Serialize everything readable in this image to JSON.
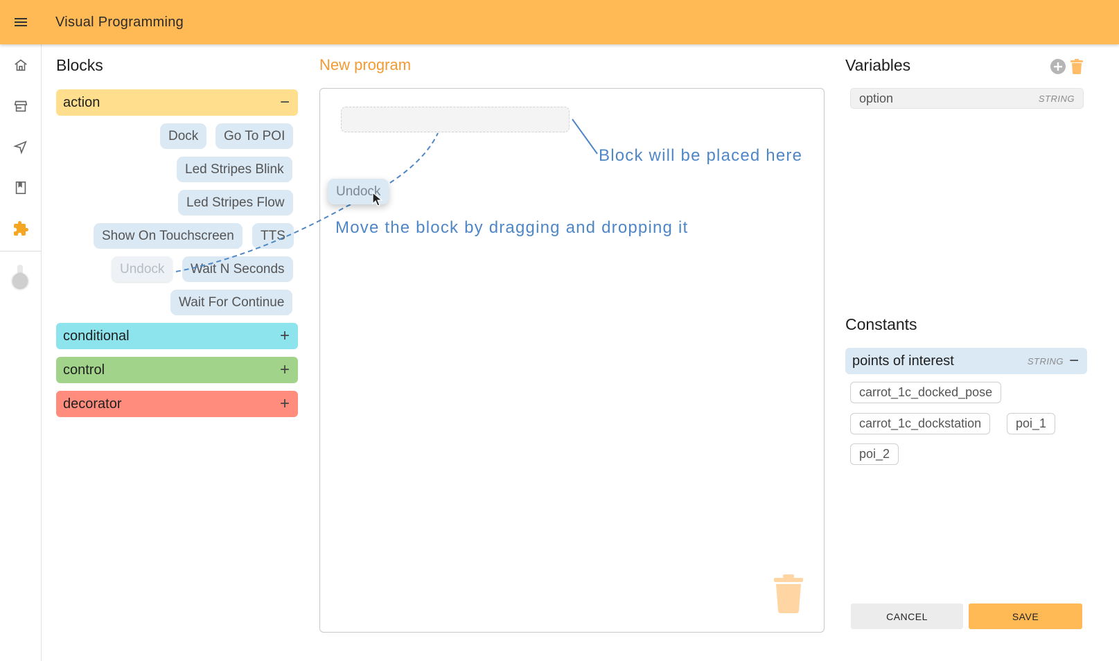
{
  "app": {
    "title": "Visual Programming"
  },
  "sidebar": {
    "items": [
      {
        "icon": "home-icon"
      },
      {
        "icon": "store-icon"
      },
      {
        "icon": "send-icon"
      },
      {
        "icon": "bookmark-icon"
      },
      {
        "icon": "puzzle-icon",
        "active": true
      }
    ]
  },
  "blocks": {
    "title": "Blocks",
    "categories": [
      {
        "label": "action",
        "color": "#ffdf8e",
        "sign": "−",
        "expanded": true
      },
      {
        "label": "conditional",
        "color": "#8ee4ec",
        "sign": "+"
      },
      {
        "label": "control",
        "color": "#a1d48a",
        "sign": "+"
      },
      {
        "label": "decorator",
        "color": "#ff8c7c",
        "sign": "+"
      }
    ],
    "action_items": [
      "Dock",
      "Go To POI",
      "Led Stripes Blink",
      "Led Stripes Flow",
      "Show On Touchscreen",
      "TTS",
      "Undock",
      "Wait N Seconds",
      "Wait For Continue"
    ]
  },
  "program": {
    "title": "New program",
    "dragging_block": "Undock",
    "hint_drop": "Block will be placed here",
    "hint_move": "Move the block by dragging and dropping it"
  },
  "variables": {
    "title": "Variables",
    "items": [
      {
        "name": "option",
        "type": "STRING"
      }
    ]
  },
  "constants": {
    "title": "Constants",
    "category": {
      "label": "points of interest",
      "type": "STRING",
      "sign": "−"
    },
    "items": [
      "carrot_1c_docked_pose",
      "carrot_1c_dockstation",
      "poi_1",
      "poi_2"
    ]
  },
  "actions": {
    "cancel": "CANCEL",
    "save": "SAVE"
  },
  "colors": {
    "accent": "#ffb955",
    "hint": "#4f87c6",
    "program_title": "#f39a33"
  }
}
